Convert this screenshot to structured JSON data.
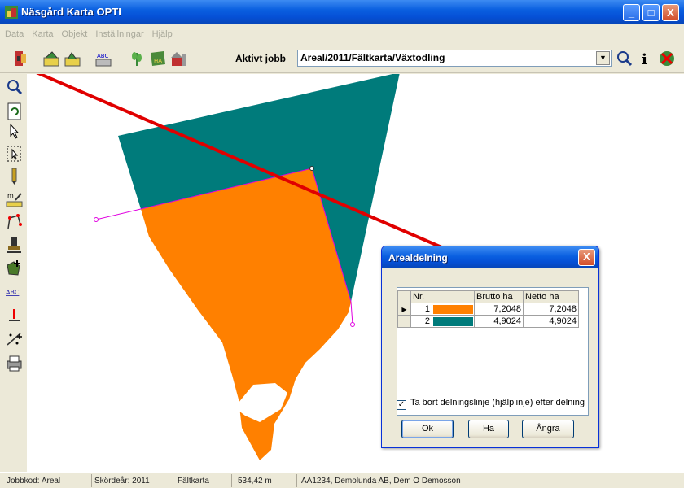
{
  "window": {
    "title": "Näsgård Karta OPTI",
    "minimize": "_",
    "maximize": "□",
    "close": "X"
  },
  "menu": [
    "Data",
    "Karta",
    "Objekt",
    "Inställningar",
    "Hjälp"
  ],
  "toolbar": {
    "job_label": "Aktivt jobb",
    "job_value": "Areal/2011/Fältkarta/Växtodling",
    "icons": [
      "exit-icon",
      "edit-map-icon",
      "layer-icon",
      "text-abc-icon",
      "crop-icon",
      "ha-field-icon",
      "farm-icon",
      "zoom-icon",
      "info-icon",
      "close-job-icon"
    ],
    "button_labels": {
      "text_abc": "ABC",
      "ha": "HA",
      "info": "i"
    }
  },
  "left_tools": [
    "zoom-icon",
    "refresh-icon",
    "select-arrow-icon",
    "select-area-icon",
    "pencil-icon",
    "measure-icon",
    "vertex-edit-icon",
    "stamp-icon",
    "add-object-icon",
    "text-icon",
    "point-icon",
    "split-line-icon",
    "print-icon"
  ],
  "left_tool_labels": {
    "measure": "m",
    "text": "ABC"
  },
  "map": {
    "teal_color": "#007b7b",
    "orange_color": "#ff8000",
    "line_color": "#e000e0",
    "arrow_color": "#e00000"
  },
  "dialog": {
    "title": "Arealdelning",
    "close": "X",
    "columns": [
      "Nr.",
      "",
      "Brutto ha",
      "Netto ha"
    ],
    "rows": [
      {
        "nr": "1",
        "color": "#ff8000",
        "brutto": "7,2048",
        "netto": "7,2048",
        "selected": true
      },
      {
        "nr": "2",
        "color": "#007b7b",
        "brutto": "4,9024",
        "netto": "4,9024",
        "selected": false
      }
    ],
    "checkbox_label": "Ta bort delningslinje (hjälplinje) efter delning",
    "checkbox_checked": true,
    "buttons": {
      "ok": "Ok",
      "ha": "Ha",
      "undo": "Ångra"
    }
  },
  "status": {
    "jobbkod": "Jobbkod: Areal",
    "skordear": "Skördeår: 2011",
    "map": "Fältkarta",
    "measure": "534,42 m",
    "owner": "AA1234, Demolunda AB, Dem O Demosson"
  }
}
